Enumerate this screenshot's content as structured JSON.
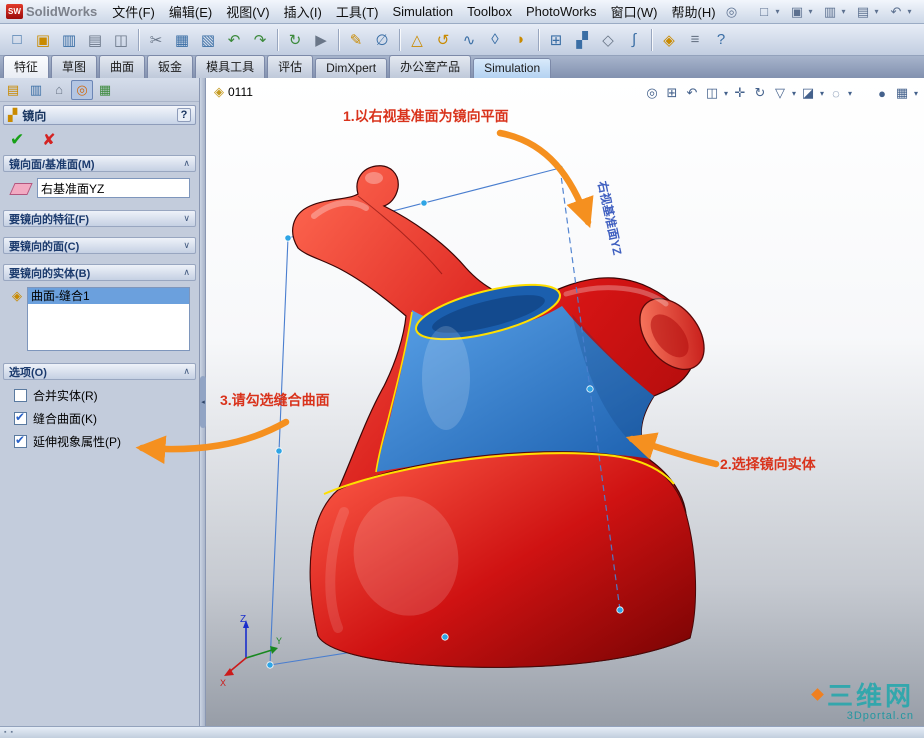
{
  "ui": {
    "caret": "▾"
  },
  "colors": {
    "annotation_text": "#d9331c",
    "arrow": "#f5901f",
    "plane_label": "#3f5fc0",
    "selection_blue": "#6ba0dd",
    "model_red": "#d41414",
    "mirror_surface_blue": "#2f7fd0",
    "stitch_edge_yellow": "#ffdf00",
    "watermark_teal": "#20a7ac"
  },
  "titlebar": {
    "logo_mark": "SW",
    "logo_text": "SolidWorks",
    "menus": [
      "文件(F)",
      "编辑(E)",
      "视图(V)",
      "插入(I)",
      "工具(T)",
      "Simulation",
      "Toolbox",
      "PhotoWorks",
      "窗口(W)",
      "帮助(H)"
    ],
    "quick_icons": [
      {
        "name": "solidworks-search",
        "glyph": "◎"
      },
      {
        "name": "new-document",
        "glyph": "□"
      },
      {
        "name": "open-document",
        "glyph": "▣"
      },
      {
        "name": "save",
        "glyph": "▥"
      },
      {
        "name": "print",
        "glyph": "▤"
      },
      {
        "name": "undo",
        "glyph": "↶"
      }
    ]
  },
  "feature_toolbar": {
    "icons": [
      {
        "name": "new",
        "glyph": "□"
      },
      {
        "name": "open",
        "glyph": "▣"
      },
      {
        "name": "save",
        "glyph": "▥"
      },
      {
        "name": "print",
        "glyph": "▤"
      },
      {
        "name": "print-preview",
        "glyph": "◫"
      },
      {
        "name": "cut",
        "glyph": "✂"
      },
      {
        "name": "copy",
        "glyph": "▦"
      },
      {
        "name": "paste",
        "glyph": "▧"
      },
      {
        "name": "undo",
        "glyph": "↶"
      },
      {
        "name": "redo",
        "glyph": "↷"
      },
      {
        "name": "rebuild",
        "glyph": "↻"
      },
      {
        "name": "select",
        "glyph": "▶"
      },
      {
        "name": "sketch",
        "glyph": "✎"
      },
      {
        "name": "smart-dimension",
        "glyph": "∅"
      },
      {
        "name": "extruded-boss",
        "glyph": "△"
      },
      {
        "name": "revolved-boss",
        "glyph": "↺"
      },
      {
        "name": "swept-boss",
        "glyph": "∿"
      },
      {
        "name": "lofted-boss",
        "glyph": "◊"
      },
      {
        "name": "fillet",
        "glyph": "◗"
      },
      {
        "name": "linear-pattern",
        "glyph": "⊞"
      },
      {
        "name": "mirror",
        "glyph": "▞"
      },
      {
        "name": "reference-geometry",
        "glyph": "◇"
      },
      {
        "name": "curves",
        "glyph": "∫"
      },
      {
        "name": "instant3d",
        "glyph": "◈"
      },
      {
        "name": "options",
        "glyph": "≡"
      },
      {
        "name": "help",
        "glyph": "?"
      }
    ]
  },
  "tabstrip": {
    "tabs": [
      {
        "label": "特征",
        "state": "active"
      },
      {
        "label": "草图",
        "state": "normal"
      },
      {
        "label": "曲面",
        "state": "normal"
      },
      {
        "label": "钣金",
        "state": "normal"
      },
      {
        "label": "模具工具",
        "state": "normal"
      },
      {
        "label": "评估",
        "state": "normal"
      },
      {
        "label": "DimXpert",
        "state": "normal"
      },
      {
        "label": "办公室产品",
        "state": "normal"
      },
      {
        "label": "Simulation",
        "state": "highlight"
      }
    ]
  },
  "pm": {
    "tabs": [
      {
        "name": "featuremanager-design-tree",
        "glyph": "▤"
      },
      {
        "name": "propertymanager",
        "glyph": "▥"
      },
      {
        "name": "configurationmanager",
        "glyph": "⌂"
      },
      {
        "name": "dimxpertmanager",
        "glyph": "◎"
      },
      {
        "name": "displaymanager",
        "glyph": "▦"
      }
    ],
    "title": "镜向",
    "help_glyph": "?",
    "ok_glyph": "✔",
    "cancel_glyph": "✘",
    "mirror_icon_glyph": "▞",
    "body_icon_glyph": "◈",
    "sections": {
      "plane": {
        "header": "镜向面/基准面(M)",
        "chevron": "∧",
        "value": "右基准面YZ"
      },
      "features": {
        "header": "要镜向的特征(F)",
        "chevron": "∨"
      },
      "faces": {
        "header": "要镜向的面(C)",
        "chevron": "∨"
      },
      "bodies": {
        "header": "要镜向的实体(B)",
        "chevron": "∧",
        "items": [
          {
            "label": "曲面-缝合1",
            "selected": true
          }
        ]
      },
      "options": {
        "header": "选项(O)",
        "chevron": "∧",
        "checkboxes": [
          {
            "label": "合并实体(R)",
            "checked": false
          },
          {
            "label": "缝合曲面(K)",
            "checked": true
          },
          {
            "label": "延伸视象属性(P)",
            "checked": true
          }
        ]
      }
    }
  },
  "splitter": {
    "glyph": "◂"
  },
  "viewport": {
    "doc_label": "0111",
    "doc_icon_glyph": "◈",
    "hud_icons": [
      {
        "name": "zoom-fit",
        "glyph": "◎"
      },
      {
        "name": "zoom-area",
        "glyph": "⊞"
      },
      {
        "name": "previous-view",
        "glyph": "↶"
      },
      {
        "name": "section-view",
        "glyph": "◫"
      },
      {
        "name": "pan",
        "glyph": "✛"
      },
      {
        "name": "rotate-view",
        "glyph": "↻"
      },
      {
        "name": "view-orientation",
        "glyph": "▽"
      },
      {
        "name": "display-style",
        "glyph": "◪"
      },
      {
        "name": "hide-show-items",
        "glyph": "◌"
      },
      {
        "name": "edit-appearance",
        "glyph": "●"
      },
      {
        "name": "apply-scene",
        "glyph": "▦"
      }
    ],
    "plane_label": "右视基准面YZ",
    "selected_body_label": "曲面-缝合1",
    "annotations": [
      {
        "text": "1.以右视基准面为镜向平面"
      },
      {
        "text": "2.选择镜向实体"
      },
      {
        "text": "3.请勾选缝合曲面"
      }
    ],
    "triad": {
      "x": "X",
      "y": "Y",
      "z": "Z"
    },
    "watermark": {
      "title": "三维网",
      "subtitle": "3Dportal.cn"
    }
  },
  "statusbar": {
    "icons": [
      {
        "name": "status-grid",
        "glyph": "▪"
      },
      {
        "name": "status-cell",
        "glyph": "▪"
      }
    ]
  }
}
